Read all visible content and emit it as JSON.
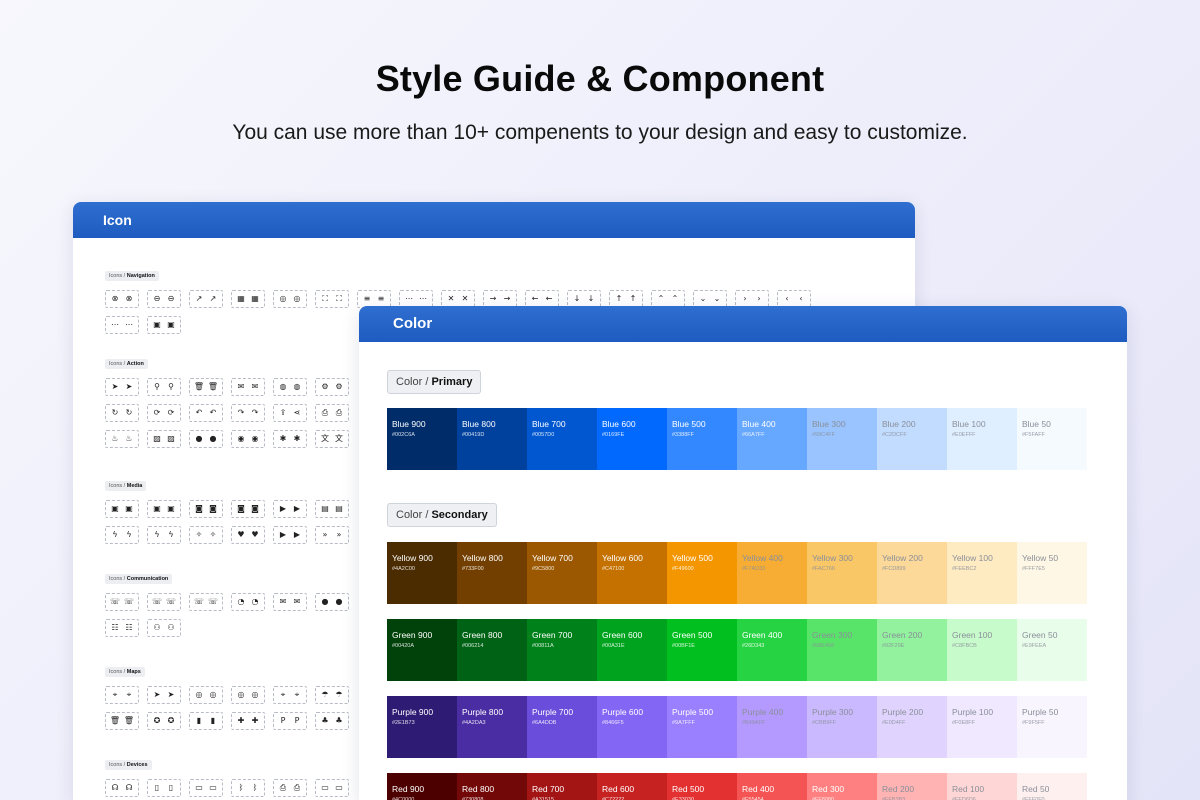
{
  "hero": {
    "title": "Style Guide & Component",
    "subtitle": "You can use more than 10+ compenents to your design and easy to customize."
  },
  "icon_panel": {
    "title": "Icon",
    "sections": [
      {
        "prefix": "Icons /",
        "name": "Navigation",
        "rows": [
          [
            [
              "close-circle-icon",
              "close-circle-outline-icon"
            ],
            [
              "minus-circle-icon",
              "minus-circle-outline-icon"
            ],
            [
              "external-link-icon",
              "external-link-alt-icon"
            ],
            [
              "grid-icon",
              "grid-outline-icon"
            ],
            [
              "compass-icon",
              "compass-outline-icon"
            ],
            [
              "expand-icon",
              "fullscreen-icon"
            ],
            [
              "menu-icon",
              "menu-alt-icon"
            ],
            [
              "more-horizontal-icon",
              "more-vertical-icon"
            ],
            [
              "x-icon",
              "x-alt-icon"
            ],
            [
              "arrow-right-icon",
              "arrow-right-alt-icon"
            ],
            [
              "arrow-left-icon",
              "arrow-left-alt-icon"
            ],
            [
              "arrow-down-icon",
              "arrow-down-alt-icon"
            ],
            [
              "arrow-up-icon",
              "arrow-up-alt-icon"
            ],
            [
              "chevron-up-icon",
              "chevron-up-alt-icon"
            ],
            [
              "chevron-down-icon",
              "chevron-down-alt-icon"
            ],
            [
              "chevron-right-icon",
              "chevron-right-alt-icon"
            ],
            [
              "chevron-left-icon",
              "chevron-left-alt-icon"
            ]
          ],
          [
            [
              "more-circle-icon",
              "more-circle-outline-icon"
            ],
            [
              "image-frame-icon",
              "image-frame-outline-icon"
            ]
          ]
        ]
      },
      {
        "prefix": "Icons /",
        "name": "Action",
        "rows": [
          [
            [
              "send-icon",
              "send-outline-icon"
            ],
            [
              "search-icon",
              "search-alt-icon"
            ],
            [
              "trash-icon",
              "trash-outline-icon"
            ],
            [
              "inbox-icon",
              "inbox-outline-icon"
            ],
            [
              "globe-icon",
              "globe-outline-icon"
            ],
            [
              "settings-icon",
              "settings-outline-icon"
            ]
          ],
          [
            [
              "refresh-icon",
              "refresh-alt-icon"
            ],
            [
              "sync-icon",
              "sync-outline-icon"
            ],
            [
              "undo-icon",
              "undo-outline-icon"
            ],
            [
              "redo-icon",
              "redo-outline-icon"
            ],
            [
              "upload-icon",
              "share-icon"
            ],
            [
              "printer-icon",
              "printer-outline-icon"
            ]
          ],
          [
            [
              "fire-icon",
              "fire-outline-icon"
            ],
            [
              "photo-icon",
              "photo-outline-icon"
            ],
            [
              "drop-icon",
              "drop-outline-icon"
            ],
            [
              "record-icon",
              "record-outline-icon"
            ],
            [
              "bug-icon",
              "bug-outline-icon"
            ],
            [
              "translate-icon",
              "translate-outline-icon"
            ]
          ]
        ]
      },
      {
        "prefix": "Icons /",
        "name": "Media",
        "rows": [
          [
            [
              "image-icon",
              "image-outline-icon"
            ],
            [
              "image-off-icon",
              "image-off-outline-icon"
            ],
            [
              "camera-icon",
              "camera-outline-icon"
            ],
            [
              "camera-off-icon",
              "camera-off-outline-icon"
            ],
            [
              "video-icon",
              "video-outline-icon"
            ],
            [
              "film-icon",
              "film-outline-icon"
            ]
          ],
          [
            [
              "flash-icon",
              "flash-outline-icon"
            ],
            [
              "flash-off-icon",
              "flash-off-outline-icon"
            ],
            [
              "magic-wand-icon",
              "magic-wand-outline-icon"
            ],
            [
              "heart-icon",
              "heart-outline-icon"
            ],
            [
              "play-icon",
              "play-outline-icon"
            ],
            [
              "fast-forward-icon",
              "fast-forward-outline-icon"
            ]
          ]
        ]
      },
      {
        "prefix": "Icons /",
        "name": "Communication",
        "rows": [
          [
            [
              "phone-icon",
              "phone-outline-icon"
            ],
            [
              "phone-hangup-icon",
              "phone-hangup-outline-icon"
            ],
            [
              "phone-incoming-icon",
              "phone-outgoing-icon"
            ],
            [
              "speedometer-icon",
              "speedometer-outline-icon"
            ],
            [
              "mailbox-icon",
              "mailbox-outline-icon"
            ],
            [
              "apple-icon",
              "apple-outline-icon"
            ]
          ],
          [
            [
              "users-icon",
              "users-outline-icon"
            ],
            [
              "user-group-icon",
              "user-group-outline-icon"
            ]
          ]
        ]
      },
      {
        "prefix": "Icons /",
        "name": "Maps",
        "rows": [
          [
            [
              "pin-icon",
              "pin-outline-icon"
            ],
            [
              "navigation-icon",
              "navigation-outline-icon"
            ],
            [
              "target-icon",
              "target-outline-icon"
            ],
            [
              "compass-map-icon",
              "compass-map-outline-icon"
            ],
            [
              "pin-off-icon",
              "pin-off-outline-icon"
            ],
            [
              "umbrella-icon",
              "umbrella-outline-icon"
            ]
          ],
          [
            [
              "trash-bin-icon",
              "trash-bin-outline-icon"
            ],
            [
              "badge-icon",
              "badge-outline-icon"
            ],
            [
              "gas-station-icon",
              "gas-station-outline-icon"
            ],
            [
              "hospital-icon",
              "hospital-outline-icon"
            ],
            [
              "parking-icon",
              "parking-outline-icon"
            ],
            [
              "tree-icon",
              "tree-outline-icon"
            ]
          ]
        ]
      },
      {
        "prefix": "Icons /",
        "name": "Devices",
        "rows": [
          [
            [
              "headphones-icon",
              "headphones-outline-icon"
            ],
            [
              "mobile-icon",
              "mobile-outline-icon"
            ],
            [
              "tablet-icon",
              "tablet-outline-icon"
            ],
            [
              "bluetooth-icon",
              "bluetooth-outline-icon"
            ],
            [
              "printer-device-icon",
              "printer-device-outline-icon"
            ],
            [
              "monitor-icon",
              "monitor-outline-icon"
            ]
          ]
        ]
      }
    ]
  },
  "color_panel": {
    "title": "Color",
    "groups": [
      {
        "prefix": "Color /",
        "name": "Primary",
        "rows": [
          [
            {
              "name": "Blue 900",
              "hex": "#002C6A"
            },
            {
              "name": "Blue 800",
              "hex": "#00419D"
            },
            {
              "name": "Blue 700",
              "hex": "#0057D0"
            },
            {
              "name": "Blue 600",
              "hex": "#0169FE"
            },
            {
              "name": "Blue 500",
              "hex": "#3388FF"
            },
            {
              "name": "Blue 400",
              "hex": "#66A7FF"
            },
            {
              "name": "Blue 300",
              "hex": "#99C4FF"
            },
            {
              "name": "Blue 200",
              "hex": "#C2DCFF"
            },
            {
              "name": "Blue 100",
              "hex": "#E0EFFF"
            },
            {
              "name": "Blue 50",
              "hex": "#F5FAFF"
            }
          ]
        ]
      },
      {
        "prefix": "Color /",
        "name": "Secondary",
        "rows": [
          [
            {
              "name": "Yellow 900",
              "hex": "#4A2C00"
            },
            {
              "name": "Yellow 800",
              "hex": "#733F00"
            },
            {
              "name": "Yellow 700",
              "hex": "#9C5800"
            },
            {
              "name": "Yellow 600",
              "hex": "#C47100"
            },
            {
              "name": "Yellow 500",
              "hex": "#F49600"
            },
            {
              "name": "Yellow 400",
              "hex": "#F7AD33"
            },
            {
              "name": "Yellow 300",
              "hex": "#FAC766"
            },
            {
              "name": "Yellow 200",
              "hex": "#FCD899"
            },
            {
              "name": "Yellow 100",
              "hex": "#FEEBC2"
            },
            {
              "name": "Yellow 50",
              "hex": "#FFF7E5"
            }
          ],
          [
            {
              "name": "Green 900",
              "hex": "#00420A"
            },
            {
              "name": "Green 800",
              "hex": "#006214"
            },
            {
              "name": "Green 700",
              "hex": "#00811A"
            },
            {
              "name": "Green 600",
              "hex": "#00A31E"
            },
            {
              "name": "Green 500",
              "hex": "#00BF1E"
            },
            {
              "name": "Green 400",
              "hex": "#26D343"
            },
            {
              "name": "Green 300",
              "hex": "#58E468"
            },
            {
              "name": "Green 200",
              "hex": "#92F29E"
            },
            {
              "name": "Green 100",
              "hex": "#C8FBCB"
            },
            {
              "name": "Green 50",
              "hex": "#E9FEEA"
            }
          ],
          [
            {
              "name": "Purple 900",
              "hex": "#2E1B73"
            },
            {
              "name": "Purple 800",
              "hex": "#4A2DA3"
            },
            {
              "name": "Purple 700",
              "hex": "#6A4DDB"
            },
            {
              "name": "Purple 600",
              "hex": "#8466F5"
            },
            {
              "name": "Purple 500",
              "hex": "#9A7FFF"
            },
            {
              "name": "Purple 400",
              "hex": "#B49AFF"
            },
            {
              "name": "Purple 300",
              "hex": "#CBB9FF"
            },
            {
              "name": "Purple 200",
              "hex": "#E0D4FF"
            },
            {
              "name": "Purple 100",
              "hex": "#F0E8FF"
            },
            {
              "name": "Purple 50",
              "hex": "#F9F5FF"
            }
          ],
          [
            {
              "name": "Red 900",
              "hex": "#4C0000"
            },
            {
              "name": "Red 800",
              "hex": "#730808"
            },
            {
              "name": "Red 700",
              "hex": "#A31515"
            },
            {
              "name": "Red 600",
              "hex": "#C72222"
            },
            {
              "name": "Red 500",
              "hex": "#E33030"
            },
            {
              "name": "Red 400",
              "hex": "#F55454"
            },
            {
              "name": "Red 300",
              "hex": "#FF8080"
            },
            {
              "name": "Red 200",
              "hex": "#FFB3B3"
            },
            {
              "name": "Red 100",
              "hex": "#FFD6D6"
            },
            {
              "name": "Red 50",
              "hex": "#FFF0F0"
            }
          ]
        ]
      }
    ]
  }
}
